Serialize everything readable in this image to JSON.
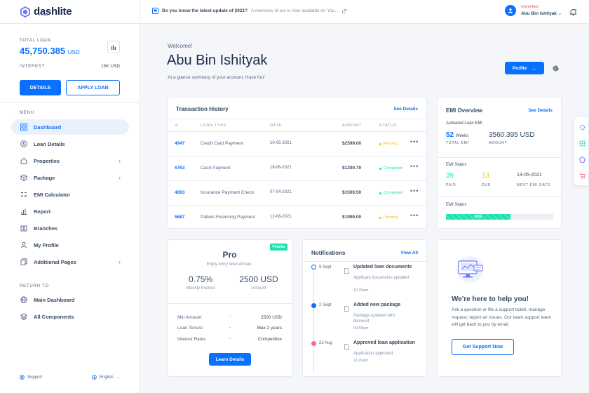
{
  "brand": {
    "name": "dashlite",
    "sub": "LOAN"
  },
  "topbar": {
    "news_bold": "Do you know the latest update of 2021?",
    "news_text": "A overview of our is now available on You...",
    "user_status": "Unverified",
    "user_name": "Abu Bin Ishtiyak"
  },
  "sidebar": {
    "total_label": "TOTAL LOAN",
    "total_amount": "45,750.385",
    "total_unit": "USD",
    "interest_label": "INTEREST",
    "interest_value": "15K USD",
    "details_button": "DETAILS",
    "apply_button": "APPLY LOAN",
    "menu_label": "MENU",
    "items": [
      {
        "label": "Dashboard",
        "icon": "dashboard-icon",
        "active": true
      },
      {
        "label": "Loan Details",
        "icon": "dollar-circle-icon"
      },
      {
        "label": "Properties",
        "icon": "home-icon",
        "has_children": true
      },
      {
        "label": "Package",
        "icon": "package-icon",
        "has_children": true
      },
      {
        "label": "EMI Calculator",
        "icon": "calculator-icon"
      },
      {
        "label": "Report",
        "icon": "bar-chart-icon"
      },
      {
        "label": "Branches",
        "icon": "building-icon"
      },
      {
        "label": "My Profile",
        "icon": "user-icon"
      },
      {
        "label": "Additional Pages",
        "icon": "pages-icon",
        "has_children": true
      }
    ],
    "return_label": "RETURN TO",
    "return_items": [
      {
        "label": "Main Dashboard",
        "icon": "globe-icon"
      },
      {
        "label": "All Components",
        "icon": "layers-icon"
      }
    ],
    "support": "Support",
    "language": "English"
  },
  "header": {
    "welcome": "Welcome!",
    "name": "Abu Bin Ishityak",
    "subtitle": "At a glance summary of your account. Have fun!",
    "profile_button": "Profile"
  },
  "transactions": {
    "title": "Transaction History",
    "see_details": "See Details",
    "columns": [
      "#",
      "LOAN TYPE",
      "DATE",
      "AMOUNT",
      "STATUS"
    ],
    "rows": [
      {
        "id": "4947",
        "type": "Credit Card Payment",
        "date": "10-05-2021",
        "amount": "$2599.00",
        "status": "Pending"
      },
      {
        "id": "5763",
        "type": "Cash Payment",
        "date": "18-06-2021",
        "amount": "$1200.70",
        "status": "Completed"
      },
      {
        "id": "4893",
        "type": "Insurance Payment Check",
        "date": "07-04-2021",
        "amount": "$1500.50",
        "status": "Completed"
      },
      {
        "id": "5687",
        "type": "Patient Financing Payment",
        "date": "12-08-2021",
        "amount": "$1999.00",
        "status": "Pending"
      }
    ]
  },
  "emi": {
    "title": "EMI Overview",
    "see_details": "See Details",
    "activated_label": "Activated Loan EMI",
    "weeks_value": "52",
    "weeks_unit": "Weeks",
    "total_emi_label": "TOTAL EMI",
    "amount_value": "3560.395 USD",
    "amount_label": "AMOUNT",
    "status_label": "EMI Status",
    "paid_value": "39",
    "paid_label": "PAID",
    "due_value": "13",
    "due_label": "DUE",
    "next_date": "13-05-2021",
    "next_label": "NEXT EMI DATE",
    "status_label2": "EMI Status",
    "progress_percent": 60,
    "progress_text": "60%"
  },
  "plan": {
    "badge": "Popular",
    "name": "Pro",
    "tagline": "Enjoy entry level of loan.",
    "interest_value": "0.75%",
    "interest_label": "Weekly Interest",
    "amount_value": "2500 USD",
    "amount_label": "Amount",
    "details": [
      {
        "label": "Min Amount",
        "value": "2500 USD"
      },
      {
        "label": "Loan Tenure",
        "value": "Max 2 years"
      },
      {
        "label": "Interest Rates",
        "value": "Competitive"
      }
    ],
    "button": "Learn Details"
  },
  "notifications": {
    "title": "Notifications",
    "view_all": "View All",
    "items": [
      {
        "date": "9 Sept",
        "title": "Updated loan documents",
        "desc": "Applicant documents updated",
        "time": "10:30am",
        "color": "#0971fe",
        "hollow": true
      },
      {
        "date": "2 Sept",
        "title": "Added new package",
        "desc": "Package updated with discount",
        "time": "09:50am",
        "color": "#0971fe",
        "hollow": false
      },
      {
        "date": "22 Aug",
        "title": "Approved loan application",
        "desc": "Application approved.",
        "time": "11:20am",
        "color": "#ff63a5",
        "hollow": false
      }
    ]
  },
  "help": {
    "title": "We're here to help you!",
    "text": "Ask a question or file a support ticket, manage request, report an issues. Our team support team will get back to you by email.",
    "button": "Get Support Now"
  }
}
